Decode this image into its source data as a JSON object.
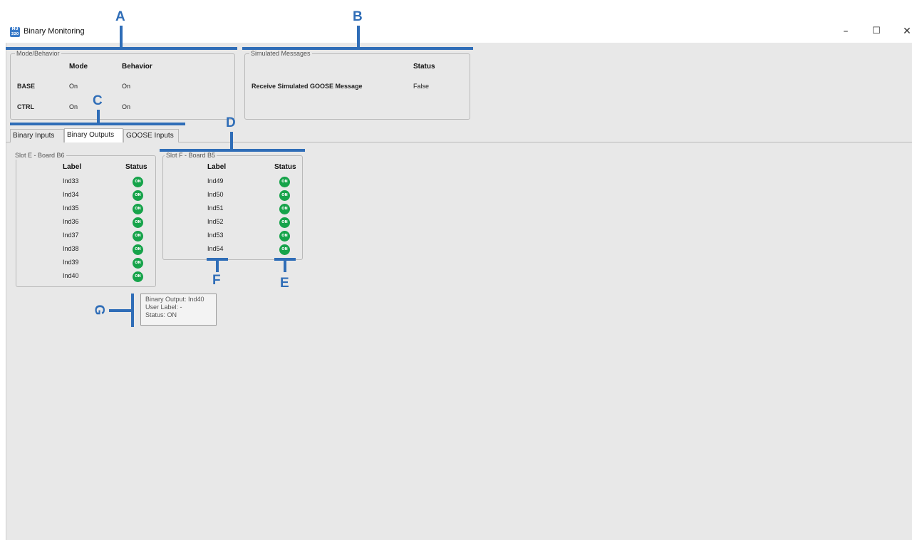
{
  "window": {
    "icon_text": "MU 320",
    "title": "Binary Monitoring",
    "minimize_glyph": "–",
    "maximize_glyph": "☐",
    "close_glyph": "✕"
  },
  "mode_behavior": {
    "legend": "Mode/Behavior",
    "col_mode": "Mode",
    "col_behavior": "Behavior",
    "rows": [
      {
        "name": "BASE",
        "mode": "On",
        "behavior": "On"
      },
      {
        "name": "CTRL",
        "mode": "On",
        "behavior": "On"
      }
    ]
  },
  "simulated_messages": {
    "legend": "Simulated Messages",
    "col_status": "Status",
    "row_label": "Receive Simulated GOOSE Message",
    "row_status": "False"
  },
  "tabs": [
    {
      "label": "Binary Inputs",
      "active": false
    },
    {
      "label": "Binary Outputs",
      "active": true
    },
    {
      "label": "GOOSE Inputs",
      "active": false
    }
  ],
  "slot_e": {
    "legend": "Slot E - Board B6",
    "col_label": "Label",
    "col_status": "Status",
    "rows": [
      {
        "label": "Ind33",
        "status": "ON"
      },
      {
        "label": "Ind34",
        "status": "ON"
      },
      {
        "label": "Ind35",
        "status": "ON"
      },
      {
        "label": "Ind36",
        "status": "ON"
      },
      {
        "label": "Ind37",
        "status": "ON"
      },
      {
        "label": "Ind38",
        "status": "ON"
      },
      {
        "label": "Ind39",
        "status": "ON"
      },
      {
        "label": "Ind40",
        "status": "ON"
      }
    ]
  },
  "slot_f": {
    "legend": "Slot F - Board B5",
    "col_label": "Label",
    "col_status": "Status",
    "rows": [
      {
        "label": "Ind49",
        "status": "ON"
      },
      {
        "label": "Ind50",
        "status": "ON"
      },
      {
        "label": "Ind51",
        "status": "ON"
      },
      {
        "label": "Ind52",
        "status": "ON"
      },
      {
        "label": "Ind53",
        "status": "ON"
      },
      {
        "label": "Ind54",
        "status": "ON"
      }
    ]
  },
  "tooltip": {
    "line1": "Binary Output: Ind40",
    "line2": "User Label: -",
    "line3": "Status: ON"
  },
  "annotations": {
    "a": "A",
    "b": "B",
    "c": "C",
    "d": "D",
    "e": "E",
    "f": "F",
    "g": "G"
  },
  "colors": {
    "annotation": "#2f6db7",
    "status_on": "#16a34a",
    "client_bg": "#e8e8e8"
  }
}
